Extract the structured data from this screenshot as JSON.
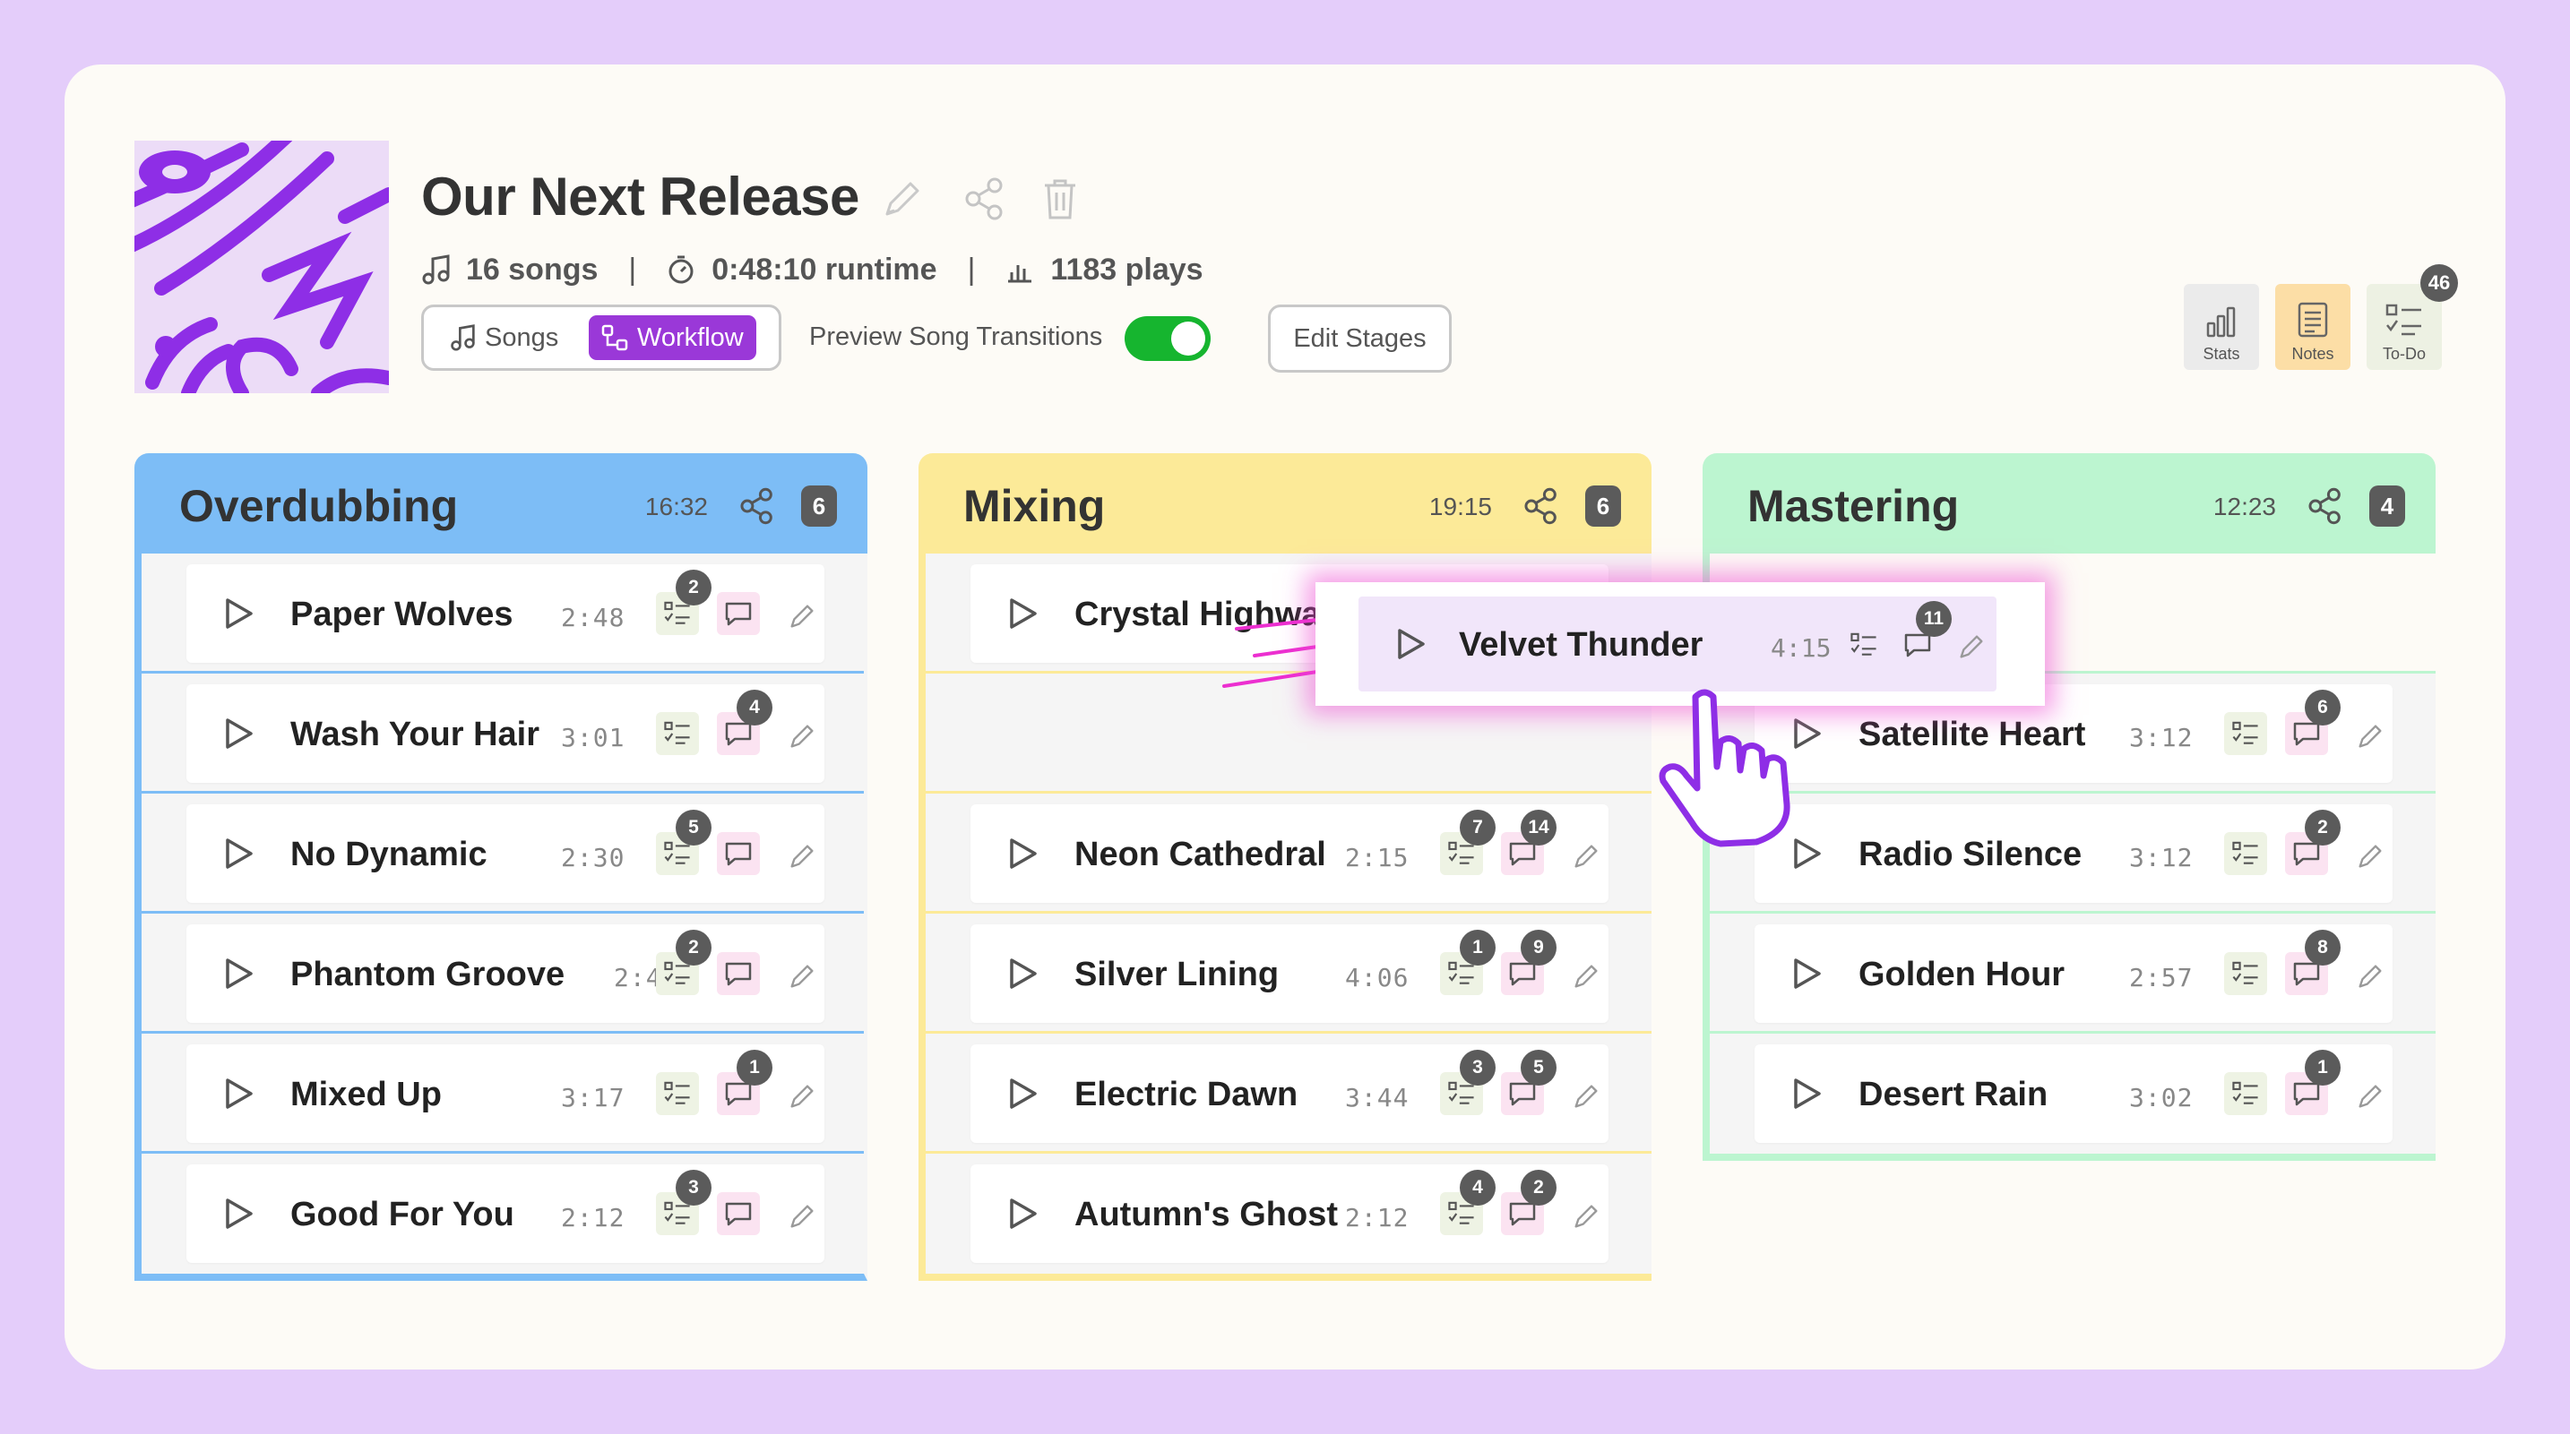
{
  "release": {
    "title": "Our Next Release",
    "songs": "16 songs",
    "runtime": "0:48:10 runtime",
    "plays": "1183 plays"
  },
  "view_toggle": {
    "songs_label": "Songs",
    "workflow_label": "Workflow",
    "selected": "Workflow"
  },
  "preview": {
    "label": "Preview Song Transitions",
    "enabled": true
  },
  "edit_stages_label": "Edit Stages",
  "tools": {
    "stats_label": "Stats",
    "notes_label": "Notes",
    "todo_label": "To-Do",
    "todo_count": "46"
  },
  "columns": [
    {
      "name": "Overdubbing",
      "duration": "16:32",
      "count": "6",
      "songs": [
        {
          "title": "Paper Wolves",
          "duration": "2:48",
          "todos": "2",
          "comments": ""
        },
        {
          "title": "Wash Your Hair",
          "duration": "3:01",
          "todos": "",
          "comments": "4"
        },
        {
          "title": "No Dynamic",
          "duration": "2:30",
          "todos": "5",
          "comments": ""
        },
        {
          "title": "Phantom Groove",
          "duration": "2:44",
          "todos": "2",
          "comments": ""
        },
        {
          "title": "Mixed Up",
          "duration": "3:17",
          "todos": "",
          "comments": "1"
        },
        {
          "title": "Good For You",
          "duration": "2:12",
          "todos": "3",
          "comments": ""
        }
      ]
    },
    {
      "name": "Mixing",
      "duration": "19:15",
      "count": "6",
      "songs": [
        {
          "title": "Crystal Highway",
          "duration": "",
          "todos": "",
          "comments": ""
        },
        {
          "title": "Neon Cathedral",
          "duration": "2:15",
          "todos": "7",
          "comments": "14"
        },
        {
          "title": "Silver Lining",
          "duration": "4:06",
          "todos": "1",
          "comments": "9"
        },
        {
          "title": "Electric Dawn",
          "duration": "3:44",
          "todos": "3",
          "comments": "5"
        },
        {
          "title": "Autumn's Ghost",
          "duration": "2:12",
          "todos": "4",
          "comments": "2"
        }
      ]
    },
    {
      "name": "Mastering",
      "duration": "12:23",
      "count": "4",
      "songs": [
        {
          "title": "Satellite Heart",
          "duration": "3:12",
          "todos": "",
          "comments": "6"
        },
        {
          "title": "Radio Silence",
          "duration": "3:12",
          "todos": "",
          "comments": "2"
        },
        {
          "title": "Golden Hour",
          "duration": "2:57",
          "todos": "",
          "comments": "8"
        },
        {
          "title": "Desert Rain",
          "duration": "3:02",
          "todos": "",
          "comments": "1"
        }
      ]
    }
  ],
  "dragging": {
    "title": "Velvet Thunder",
    "duration": "4:15",
    "todos": "",
    "comments": "11"
  },
  "colors": {
    "overdubbing": "#7dbdf6",
    "mixing": "#fcea98",
    "mastering": "#bcf5d0",
    "accent": "#9a38d8",
    "toggle_on": "#16b52f"
  }
}
